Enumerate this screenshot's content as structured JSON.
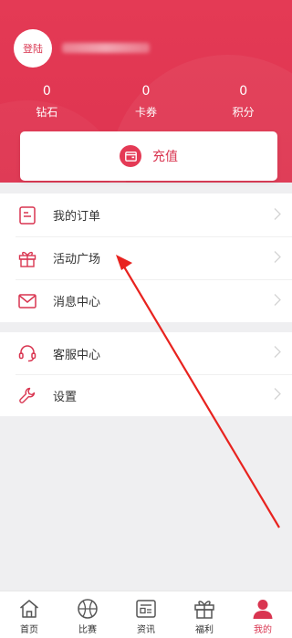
{
  "profile": {
    "login_label": "登陆"
  },
  "stats": [
    {
      "value": "0",
      "label": "钻石"
    },
    {
      "value": "0",
      "label": "卡券"
    },
    {
      "value": "0",
      "label": "积分"
    }
  ],
  "recharge": {
    "label": "充值",
    "icon": "wallet-icon"
  },
  "menu_group_1": [
    {
      "label": "我的订单",
      "icon": "order-icon"
    },
    {
      "label": "活动广场",
      "icon": "gift-icon"
    },
    {
      "label": "消息中心",
      "icon": "mail-icon"
    }
  ],
  "menu_group_2": [
    {
      "label": "客服中心",
      "icon": "headset-icon"
    },
    {
      "label": "设置",
      "icon": "wrench-icon"
    }
  ],
  "tabbar": [
    {
      "label": "首页",
      "icon": "home-icon"
    },
    {
      "label": "比赛",
      "icon": "ball-icon"
    },
    {
      "label": "资讯",
      "icon": "news-icon"
    },
    {
      "label": "福利",
      "icon": "gift-icon"
    },
    {
      "label": "我的",
      "icon": "user-icon",
      "active": true
    }
  ],
  "colors": {
    "brand": "#e43a55",
    "icon_red": "#d93550",
    "background": "#efeff1"
  }
}
